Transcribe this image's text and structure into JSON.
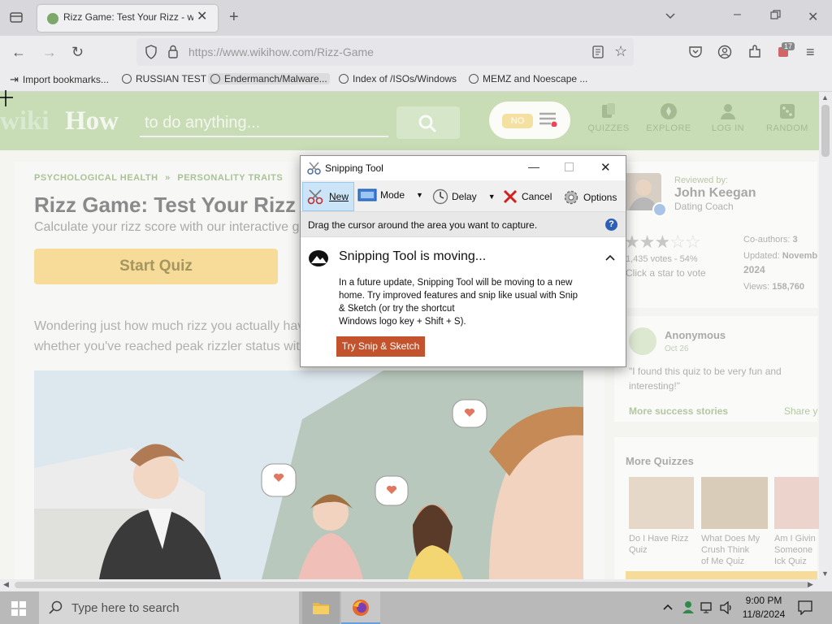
{
  "browser": {
    "tab_title": "Rizz Game: Test Your Rizz - wiki",
    "url": "https://www.wikihow.com/Rizz-Game",
    "bookmarks": [
      "Import bookmarks...",
      "RUSSIAN TEST",
      "Endermanch/Malware...",
      "Index of /ISOs/Windows",
      "MEMZ and Noescape ..."
    ],
    "extension_badge": "17"
  },
  "site": {
    "logo_wiki": "wiki",
    "logo_how": "How",
    "search_placeholder": "to do anything...",
    "toggle_label": "NO",
    "nav": [
      "QUIZZES",
      "EXPLORE",
      "LOG IN",
      "RANDOM"
    ]
  },
  "article": {
    "breadcrumb_1": "PSYCHOLOGICAL HEALTH",
    "breadcrumb_sep": "»",
    "breadcrumb_2": "PERSONALITY TRAITS",
    "title": "Rizz Game: Test Your Rizz",
    "subtitle": "Calculate your rizz score with our interactive g",
    "start_button": "Start Quiz",
    "intro_line1": "Wondering just how much rizz you actually hav",
    "intro_line2": "whether you've reached peak rizzler status wit"
  },
  "sidebar": {
    "reviewed_by": "Reviewed by:",
    "reviewer_name": "John Keegan",
    "reviewer_role": "Dating Coach",
    "votes": "1,435 votes - 54%",
    "vote_prompt": "Click a star to vote",
    "rating": 3,
    "coauthors_label": "Co-authors:",
    "coauthors_value": "3",
    "updated_label": "Updated:",
    "updated_value": "Novemb",
    "updated_year": "2024",
    "views_label": "Views:",
    "views_value": "158,760",
    "story_author": "Anonymous",
    "story_date": "Oct 26",
    "story_text_1": "\"I found this quiz to be very fun and",
    "story_text_2": "interesting!\"",
    "more_stories": "More success stories",
    "share": "Share y",
    "more_quizzes": "More Quizzes",
    "quizzes": [
      {
        "line1": "Do I Have Rizz",
        "line2": "Quiz",
        "line3": ""
      },
      {
        "line1": "What Does My",
        "line2": "Crush Think",
        "line3": "of Me Quiz"
      },
      {
        "line1": "Am I Givin",
        "line2": "Someone",
        "line3": "Ick Quiz"
      }
    ]
  },
  "snipping_tool": {
    "title": "Snipping Tool",
    "new": "New",
    "mode": "Mode",
    "delay": "Delay",
    "cancel": "Cancel",
    "options": "Options",
    "instruction": "Drag the cursor around the area you want to capture.",
    "moving_title": "Snipping Tool is moving...",
    "moving_line1": "In a future update, Snipping Tool will be moving to a new",
    "moving_line2": "home. Try improved features and snip like usual with Snip",
    "moving_line3": "& Sketch (or try the shortcut",
    "moving_line4": "Windows logo key + Shift + S).",
    "try_button": "Try Snip & Sketch"
  },
  "taskbar": {
    "search_placeholder": "Type here to search",
    "time": "9:00 PM",
    "date": "11/8/2024"
  }
}
